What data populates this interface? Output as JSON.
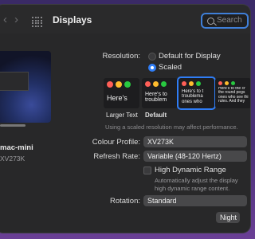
{
  "window": {
    "title": "Displays"
  },
  "search": {
    "placeholder": "Search"
  },
  "monitor": {
    "name": "mac-mini",
    "model": "XV273K"
  },
  "resolution": {
    "label": "Resolution:",
    "options": [
      {
        "label": "Default for Display",
        "selected": false
      },
      {
        "label": "Scaled",
        "selected": true
      }
    ]
  },
  "scaling": {
    "previews": [
      {
        "text": "Here's",
        "caption": "Larger Text",
        "selected": false
      },
      {
        "text": "Here's to troublem",
        "caption": "Default",
        "selected": false
      },
      {
        "text": "Here's to t troublema ones who",
        "caption": "",
        "selected": true
      },
      {
        "text": "Here's to the cr the round pegs ones who see thi rules. And they",
        "caption": "",
        "selected": false
      }
    ],
    "hint": "Using a scaled resolution may affect performance."
  },
  "colour_profile": {
    "label": "Colour Profile:",
    "value": "XV273K"
  },
  "refresh_rate": {
    "label": "Refresh Rate:",
    "value": "Variable (48-120 Hertz)"
  },
  "hdr": {
    "label": "High Dynamic Range",
    "checked": false,
    "desc_line1": "Automatically adjust the display",
    "desc_line2": "high dynamic range content."
  },
  "rotation": {
    "label": "Rotation:",
    "value": "Standard"
  },
  "night_shift": {
    "label": "Night"
  },
  "colors": {
    "accent": "#2f7df6",
    "window_bg": "#282829",
    "traffic_red": "#ff5f57",
    "traffic_yellow": "#febc2e",
    "traffic_green": "#28c840"
  }
}
